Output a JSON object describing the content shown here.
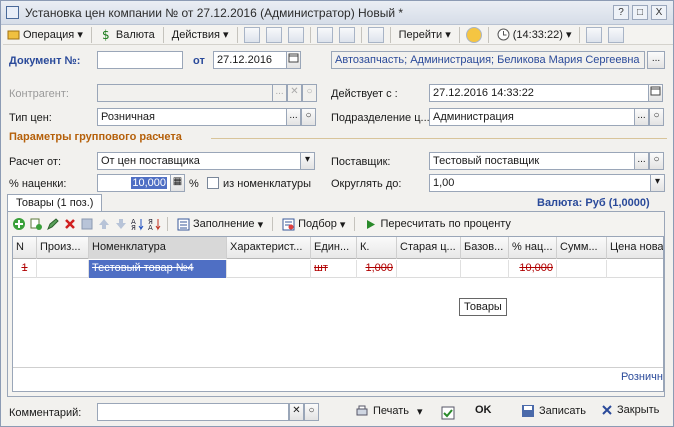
{
  "window": {
    "title": "Установка цен компании №  от 27.12.2016 (Администратор) Новый *",
    "controls": [
      "?",
      "□",
      "X"
    ]
  },
  "toolbar": {
    "operation_label": "Операция",
    "currency_label": "Валюта",
    "actions_label": "Действия",
    "goto_label": "Перейти",
    "time_label": "(14:33:22)"
  },
  "header": {
    "doc_no_label": "Документ №:",
    "doc_no_value": "",
    "from_label": "от",
    "date_value": "27.12.2016",
    "org_value": "Автозапчасть; Администрация; Беликова Мария Сергеевна"
  },
  "form": {
    "counterparty_label": "Контрагент:",
    "counterparty_value": "",
    "valid_from_label": "Действует с :",
    "valid_from_value": "27.12.2016 14:33:22",
    "price_type_label": "Тип цен:",
    "price_type_value": "Розничная",
    "department_label": "Подразделение ц...",
    "department_value": "Администрация",
    "group_section_title": "Параметры группового расчета",
    "calc_from_label": "Расчет от:",
    "calc_from_value": "От цен поставщика",
    "supplier_label": "Поставщик:",
    "supplier_value": "Тестовый поставщик",
    "markup_label": "% наценки:",
    "markup_value": "10,000",
    "percent_sign": "%",
    "from_nomenclature_label": "из номенклатуры",
    "round_label": "Округлять до:",
    "round_value": "1,00"
  },
  "tab": {
    "label": "Товары (1 поз.)",
    "currency_info": "Валюта: Руб (1,0000)",
    "fill_label": "Заполнение",
    "pick_label": "Подбор",
    "recalc_label": "Пересчитать по проценту"
  },
  "grid": {
    "columns": [
      "N",
      "Произ...",
      "Номенклатура",
      "Характерист...",
      "Един...",
      "К.",
      "Старая ц...",
      "Базов...",
      "% нац...",
      "Сумм...",
      "Цена нова"
    ],
    "rows": [
      [
        "1",
        "",
        "Тестовый товар №4",
        "",
        "шт",
        "1,000",
        "",
        "",
        "10,000",
        "",
        ""
      ]
    ],
    "footer_price_label": "Розничная"
  },
  "tooltip": "Товары",
  "bottom": {
    "comment_label": "Комментарий:",
    "comment_value": "",
    "print_label": "Печать",
    "ok_label": "OK",
    "save_label": "Записать",
    "close_label": "Закрыть"
  }
}
